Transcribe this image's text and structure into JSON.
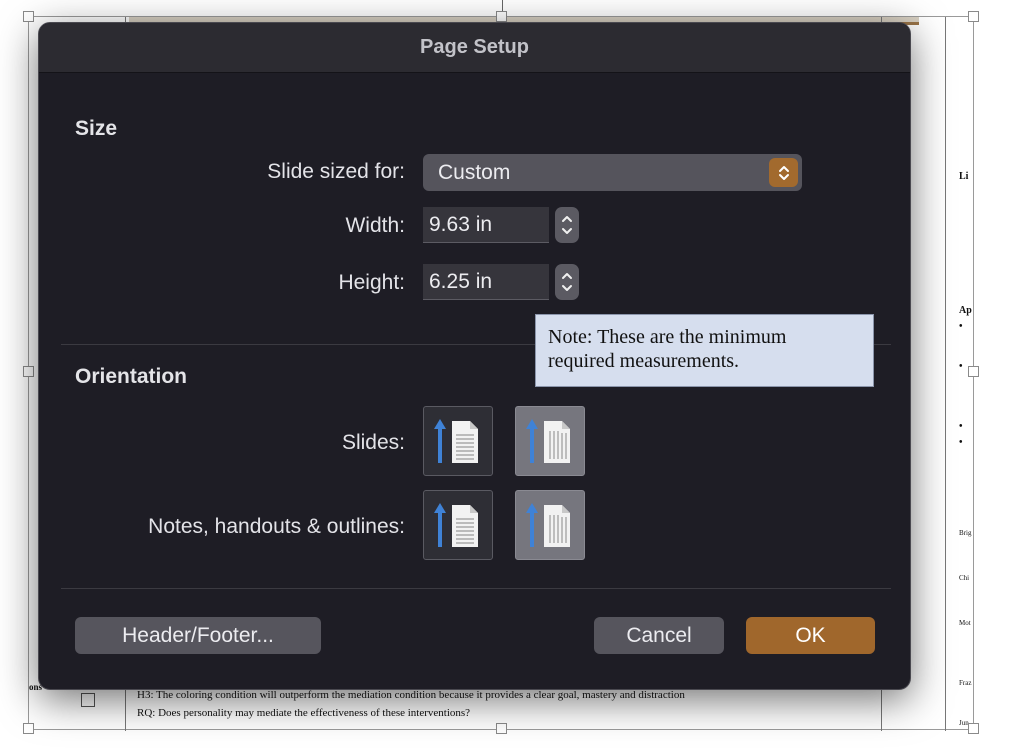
{
  "dialog": {
    "title": "Page Setup",
    "size_section": "Size",
    "slide_sized_for_label": "Slide sized for:",
    "slide_sized_for_value": "Custom",
    "width_label": "Width:",
    "width_value": "9.63 in",
    "height_label": "Height:",
    "height_value": "6.25 in",
    "orientation_section": "Orientation",
    "slides_label": "Slides:",
    "notes_label": "Notes, handouts & outlines:",
    "header_footer_button": "Header/Footer...",
    "cancel_button": "Cancel",
    "ok_button": "OK"
  },
  "note": {
    "line1": "Note: These are the minimum",
    "line2": "required measurements."
  },
  "background_doc": {
    "right_labels": [
      "Li",
      "Ap",
      "Brig",
      "Chi",
      "Mot",
      "Fraz",
      "Jun"
    ],
    "bullets": [
      "•",
      "•",
      "•",
      "•"
    ],
    "left_labels": [
      "ons"
    ],
    "bottom_line1": "H3: The coloring condition will outperform the mediation condition because it provides a clear goal, mastery and distraction",
    "bottom_line2": "RQ: Does personality may mediate the effectiveness of these interventions?"
  },
  "colors": {
    "dialog_bg": "#1e1d25",
    "accent": "#a0672c",
    "note_bg": "#d6deee",
    "orientation_arrow": "#3f82d6"
  },
  "icons": {
    "select_chevron": "chevron-up-down-icon",
    "stepper": "stepper-arrows-icon",
    "portrait": "portrait-orientation-icon",
    "landscape": "landscape-orientation-icon"
  }
}
